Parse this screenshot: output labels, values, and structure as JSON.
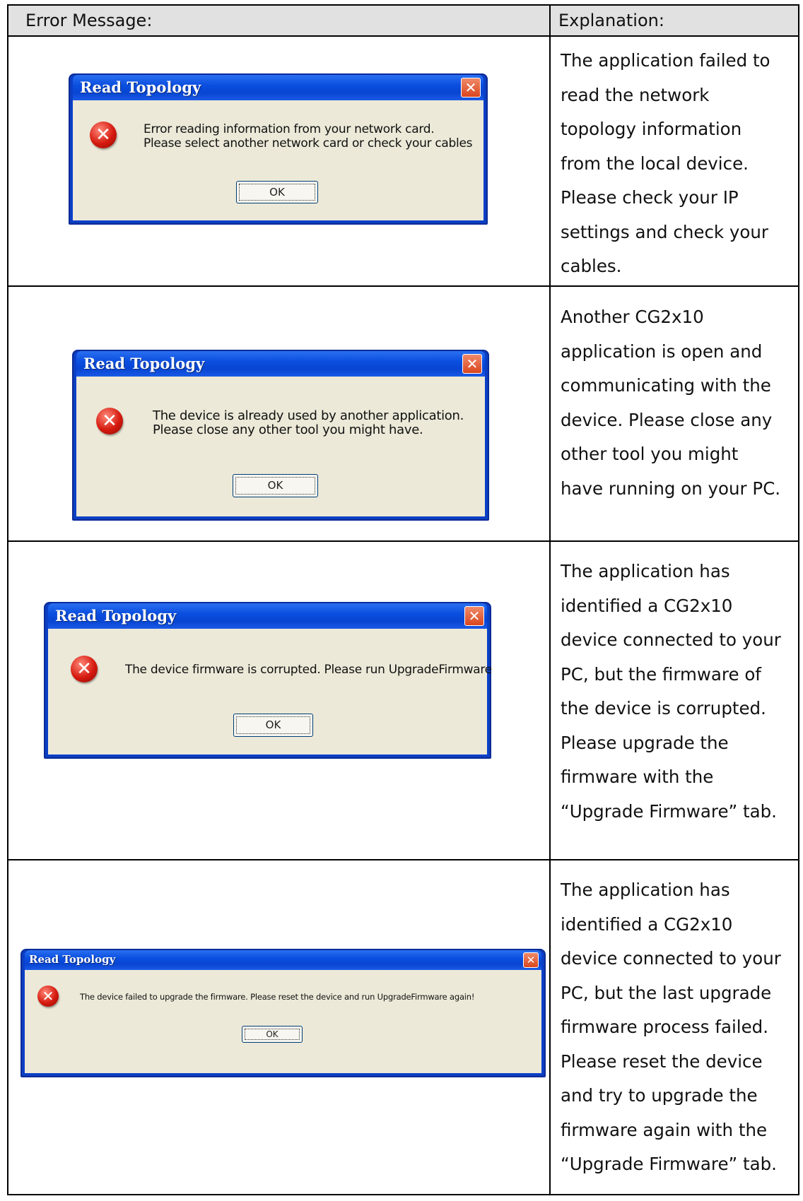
{
  "table": {
    "header": {
      "col1": "Error Message:",
      "col2": "Explanation:"
    },
    "rows": [
      {
        "dialog": {
          "title": "Read Topology",
          "message_lines": [
            "Error reading information from your network card.",
            "Please select another network card or check your cables"
          ],
          "ok_label": "OK"
        },
        "explanation_lines": [
          "The application failed to",
          "read the network",
          "topology information",
          "from the local device.",
          "Please check your IP",
          "settings and check your",
          "cables."
        ]
      },
      {
        "dialog": {
          "title": "Read Topology",
          "message_lines": [
            "The device is already used by another application.",
            "Please close any other tool you might have."
          ],
          "ok_label": "OK"
        },
        "explanation_lines": [
          "Another CG2x10",
          "application is open and",
          "communicating with the",
          "device. Please close any",
          "other tool you might",
          "have running on your PC."
        ]
      },
      {
        "dialog": {
          "title": "Read Topology",
          "message_lines": [
            "The device firmware is corrupted. Please run UpgradeFirmware"
          ],
          "ok_label": "OK"
        },
        "explanation_lines": [
          "The application has",
          "identified a CG2x10",
          "device connected to your",
          "PC, but the firmware of",
          "the device is corrupted.",
          "Please upgrade the",
          "firmware with the",
          "“Upgrade Firmware” tab."
        ]
      },
      {
        "dialog": {
          "title": "Read Topology",
          "message_lines": [
            "The device failed to upgrade the firmware. Please reset the device and run UpgradeFirmware again!"
          ],
          "ok_label": "OK"
        },
        "explanation_lines": [
          "The application has",
          "identified a CG2x10",
          "device connected to your",
          "PC, but the last upgrade",
          "firmware process failed.",
          "Please reset the device",
          "and try to upgrade the",
          "firmware again with the",
          "“Upgrade Firmware” tab."
        ]
      }
    ]
  },
  "icons": {
    "error": "error-icon",
    "close": "close-icon"
  },
  "colors": {
    "title_bar": "#0b4fe0",
    "dialog_body": "#ece9d8",
    "close_button": "#d9461e",
    "error_icon": "#d61a0f",
    "header_background": "#e1e1e1"
  }
}
